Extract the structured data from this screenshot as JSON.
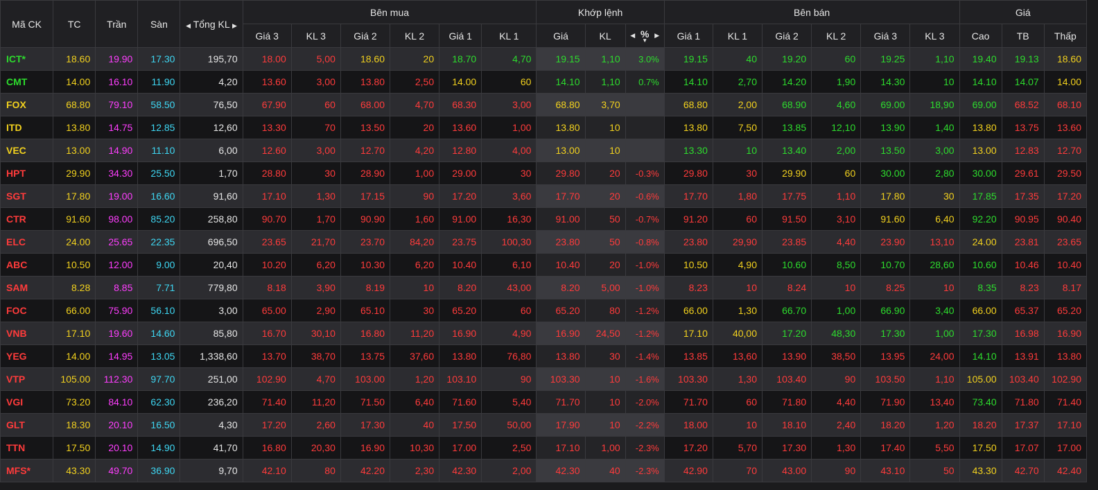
{
  "header": {
    "symbol": "Mã CK",
    "ref": "TC",
    "ceil": "Trần",
    "floor": "Sàn",
    "total_vol": "Tổng KL",
    "buy_group": "Bên mua",
    "match_group": "Khớp lệnh",
    "sell_group": "Bên bán",
    "price_group": "Giá",
    "price3": "Giá 3",
    "vol3": "KL 3",
    "price2": "Giá 2",
    "vol2": "KL 2",
    "price1": "Giá 1",
    "vol1": "KL 1",
    "match_price": "Giá",
    "match_vol": "KL",
    "match_pct": "%",
    "high": "Cao",
    "avg": "TB",
    "low": "Thấp"
  },
  "colors": {
    "up": "#2ddc2d",
    "down": "#ff3b3b",
    "ref": "#f2d11e",
    "ceil": "#ff3eff",
    "floor": "#3ed6f2",
    "neutral": "#e6e6e6"
  },
  "rows": [
    {
      "sym": "ICT*",
      "tc": "18.60",
      "ceil": "19.90",
      "floor": "17.30",
      "tv": "195,70",
      "bp3": "18.00",
      "bv3": "5,00",
      "bp2": "18.60",
      "bv2": "20",
      "bp1": "18.70",
      "bv1": "4,70",
      "mp": "19.15",
      "mv": "1,10",
      "pct": "3.0%",
      "sp1": "19.15",
      "sv1": "40",
      "sp2": "19.20",
      "sv2": "60",
      "sp3": "19.25",
      "sv3": "1,10",
      "hi": "19.40",
      "av": "19.13",
      "lo": "18.60"
    },
    {
      "sym": "CMT",
      "tc": "14.00",
      "ceil": "16.10",
      "floor": "11.90",
      "tv": "4,20",
      "bp3": "13.60",
      "bv3": "3,00",
      "bp2": "13.80",
      "bv2": "2,50",
      "bp1": "14.00",
      "bv1": "60",
      "mp": "14.10",
      "mv": "1,10",
      "pct": "0.7%",
      "sp1": "14.10",
      "sv1": "2,70",
      "sp2": "14.20",
      "sv2": "1,90",
      "sp3": "14.30",
      "sv3": "10",
      "hi": "14.10",
      "av": "14.07",
      "lo": "14.00"
    },
    {
      "sym": "FOX",
      "tc": "68.80",
      "ceil": "79.10",
      "floor": "58.50",
      "tv": "76,50",
      "bp3": "67.90",
      "bv3": "60",
      "bp2": "68.00",
      "bv2": "4,70",
      "bp1": "68.30",
      "bv1": "3,00",
      "mp": "68.80",
      "mv": "3,70",
      "pct": "",
      "sp1": "68.80",
      "sv1": "2,00",
      "sp2": "68.90",
      "sv2": "4,60",
      "sp3": "69.00",
      "sv3": "18,90",
      "hi": "69.00",
      "av": "68.52",
      "lo": "68.10"
    },
    {
      "sym": "ITD",
      "tc": "13.80",
      "ceil": "14.75",
      "floor": "12.85",
      "tv": "12,60",
      "bp3": "13.30",
      "bv3": "70",
      "bp2": "13.50",
      "bv2": "20",
      "bp1": "13.60",
      "bv1": "1,00",
      "mp": "13.80",
      "mv": "10",
      "pct": "",
      "sp1": "13.80",
      "sv1": "7,50",
      "sp2": "13.85",
      "sv2": "12,10",
      "sp3": "13.90",
      "sv3": "1,40",
      "hi": "13.80",
      "av": "13.75",
      "lo": "13.60"
    },
    {
      "sym": "VEC",
      "tc": "13.00",
      "ceil": "14.90",
      "floor": "11.10",
      "tv": "6,00",
      "bp3": "12.60",
      "bv3": "3,00",
      "bp2": "12.70",
      "bv2": "4,20",
      "bp1": "12.80",
      "bv1": "4,00",
      "mp": "13.00",
      "mv": "10",
      "pct": "",
      "sp1": "13.30",
      "sv1": "10",
      "sp2": "13.40",
      "sv2": "2,00",
      "sp3": "13.50",
      "sv3": "3,00",
      "hi": "13.00",
      "av": "12.83",
      "lo": "12.70"
    },
    {
      "sym": "HPT",
      "tc": "29.90",
      "ceil": "34.30",
      "floor": "25.50",
      "tv": "1,70",
      "bp3": "28.80",
      "bv3": "30",
      "bp2": "28.90",
      "bv2": "1,00",
      "bp1": "29.00",
      "bv1": "30",
      "mp": "29.80",
      "mv": "20",
      "pct": "-0.3%",
      "sp1": "29.80",
      "sv1": "30",
      "sp2": "29.90",
      "sv2": "60",
      "sp3": "30.00",
      "sv3": "2,80",
      "hi": "30.00",
      "av": "29.61",
      "lo": "29.50"
    },
    {
      "sym": "SGT",
      "tc": "17.80",
      "ceil": "19.00",
      "floor": "16.60",
      "tv": "91,60",
      "bp3": "17.10",
      "bv3": "1,30",
      "bp2": "17.15",
      "bv2": "90",
      "bp1": "17.20",
      "bv1": "3,60",
      "mp": "17.70",
      "mv": "20",
      "pct": "-0.6%",
      "sp1": "17.70",
      "sv1": "1,80",
      "sp2": "17.75",
      "sv2": "1,10",
      "sp3": "17.80",
      "sv3": "30",
      "hi": "17.85",
      "av": "17.35",
      "lo": "17.20"
    },
    {
      "sym": "CTR",
      "tc": "91.60",
      "ceil": "98.00",
      "floor": "85.20",
      "tv": "258,80",
      "bp3": "90.70",
      "bv3": "1,70",
      "bp2": "90.90",
      "bv2": "1,60",
      "bp1": "91.00",
      "bv1": "16,30",
      "mp": "91.00",
      "mv": "50",
      "pct": "-0.7%",
      "sp1": "91.20",
      "sv1": "60",
      "sp2": "91.50",
      "sv2": "3,10",
      "sp3": "91.60",
      "sv3": "6,40",
      "hi": "92.20",
      "av": "90.95",
      "lo": "90.40"
    },
    {
      "sym": "ELC",
      "tc": "24.00",
      "ceil": "25.65",
      "floor": "22.35",
      "tv": "696,50",
      "bp3": "23.65",
      "bv3": "21,70",
      "bp2": "23.70",
      "bv2": "84,20",
      "bp1": "23.75",
      "bv1": "100,30",
      "mp": "23.80",
      "mv": "50",
      "pct": "-0.8%",
      "sp1": "23.80",
      "sv1": "29,90",
      "sp2": "23.85",
      "sv2": "4,40",
      "sp3": "23.90",
      "sv3": "13,10",
      "hi": "24.00",
      "av": "23.81",
      "lo": "23.65"
    },
    {
      "sym": "ABC",
      "tc": "10.50",
      "ceil": "12.00",
      "floor": "9.00",
      "tv": "20,40",
      "bp3": "10.20",
      "bv3": "6,20",
      "bp2": "10.30",
      "bv2": "6,20",
      "bp1": "10.40",
      "bv1": "6,10",
      "mp": "10.40",
      "mv": "20",
      "pct": "-1.0%",
      "sp1": "10.50",
      "sv1": "4,90",
      "sp2": "10.60",
      "sv2": "8,50",
      "sp3": "10.70",
      "sv3": "28,60",
      "hi": "10.60",
      "av": "10.46",
      "lo": "10.40"
    },
    {
      "sym": "SAM",
      "tc": "8.28",
      "ceil": "8.85",
      "floor": "7.71",
      "tv": "779,80",
      "bp3": "8.18",
      "bv3": "3,90",
      "bp2": "8.19",
      "bv2": "10",
      "bp1": "8.20",
      "bv1": "43,00",
      "mp": "8.20",
      "mv": "5,00",
      "pct": "-1.0%",
      "sp1": "8.23",
      "sv1": "10",
      "sp2": "8.24",
      "sv2": "10",
      "sp3": "8.25",
      "sv3": "10",
      "hi": "8.35",
      "av": "8.23",
      "lo": "8.17"
    },
    {
      "sym": "FOC",
      "tc": "66.00",
      "ceil": "75.90",
      "floor": "56.10",
      "tv": "3,00",
      "bp3": "65.00",
      "bv3": "2,90",
      "bp2": "65.10",
      "bv2": "30",
      "bp1": "65.20",
      "bv1": "60",
      "mp": "65.20",
      "mv": "80",
      "pct": "-1.2%",
      "sp1": "66.00",
      "sv1": "1,30",
      "sp2": "66.70",
      "sv2": "1,00",
      "sp3": "66.90",
      "sv3": "3,40",
      "hi": "66.00",
      "av": "65.37",
      "lo": "65.20"
    },
    {
      "sym": "VNB",
      "tc": "17.10",
      "ceil": "19.60",
      "floor": "14.60",
      "tv": "85,80",
      "bp3": "16.70",
      "bv3": "30,10",
      "bp2": "16.80",
      "bv2": "11,20",
      "bp1": "16.90",
      "bv1": "4,90",
      "mp": "16.90",
      "mv": "24,50",
      "pct": "-1.2%",
      "sp1": "17.10",
      "sv1": "40,00",
      "sp2": "17.20",
      "sv2": "48,30",
      "sp3": "17.30",
      "sv3": "1,00",
      "hi": "17.30",
      "av": "16.98",
      "lo": "16.90"
    },
    {
      "sym": "YEG",
      "tc": "14.00",
      "ceil": "14.95",
      "floor": "13.05",
      "tv": "1,338,60",
      "bp3": "13.70",
      "bv3": "38,70",
      "bp2": "13.75",
      "bv2": "37,60",
      "bp1": "13.80",
      "bv1": "76,80",
      "mp": "13.80",
      "mv": "30",
      "pct": "-1.4%",
      "sp1": "13.85",
      "sv1": "13,60",
      "sp2": "13.90",
      "sv2": "38,50",
      "sp3": "13.95",
      "sv3": "24,00",
      "hi": "14.10",
      "av": "13.91",
      "lo": "13.80"
    },
    {
      "sym": "VTP",
      "tc": "105.00",
      "ceil": "112.30",
      "floor": "97.70",
      "tv": "251,00",
      "bp3": "102.90",
      "bv3": "4,70",
      "bp2": "103.00",
      "bv2": "1,20",
      "bp1": "103.10",
      "bv1": "90",
      "mp": "103.30",
      "mv": "10",
      "pct": "-1.6%",
      "sp1": "103.30",
      "sv1": "1,30",
      "sp2": "103.40",
      "sv2": "90",
      "sp3": "103.50",
      "sv3": "1,10",
      "hi": "105.00",
      "av": "103.40",
      "lo": "102.90"
    },
    {
      "sym": "VGI",
      "tc": "73.20",
      "ceil": "84.10",
      "floor": "62.30",
      "tv": "236,20",
      "bp3": "71.40",
      "bv3": "11,20",
      "bp2": "71.50",
      "bv2": "6,40",
      "bp1": "71.60",
      "bv1": "5,40",
      "mp": "71.70",
      "mv": "10",
      "pct": "-2.0%",
      "sp1": "71.70",
      "sv1": "60",
      "sp2": "71.80",
      "sv2": "4,40",
      "sp3": "71.90",
      "sv3": "13,40",
      "hi": "73.40",
      "av": "71.80",
      "lo": "71.40"
    },
    {
      "sym": "GLT",
      "tc": "18.30",
      "ceil": "20.10",
      "floor": "16.50",
      "tv": "4,30",
      "bp3": "17.20",
      "bv3": "2,60",
      "bp2": "17.30",
      "bv2": "40",
      "bp1": "17.50",
      "bv1": "50,00",
      "mp": "17.90",
      "mv": "10",
      "pct": "-2.2%",
      "sp1": "18.00",
      "sv1": "10",
      "sp2": "18.10",
      "sv2": "2,40",
      "sp3": "18.20",
      "sv3": "1,20",
      "hi": "18.20",
      "av": "17.37",
      "lo": "17.10"
    },
    {
      "sym": "TTN",
      "tc": "17.50",
      "ceil": "20.10",
      "floor": "14.90",
      "tv": "41,70",
      "bp3": "16.80",
      "bv3": "20,30",
      "bp2": "16.90",
      "bv2": "10,30",
      "bp1": "17.00",
      "bv1": "2,50",
      "mp": "17.10",
      "mv": "1,00",
      "pct": "-2.3%",
      "sp1": "17.20",
      "sv1": "5,70",
      "sp2": "17.30",
      "sv2": "1,30",
      "sp3": "17.40",
      "sv3": "5,50",
      "hi": "17.50",
      "av": "17.07",
      "lo": "17.00"
    },
    {
      "sym": "MFS*",
      "tc": "43.30",
      "ceil": "49.70",
      "floor": "36.90",
      "tv": "9,70",
      "bp3": "42.10",
      "bv3": "80",
      "bp2": "42.20",
      "bv2": "2,30",
      "bp1": "42.30",
      "bv1": "2,00",
      "mp": "42.30",
      "mv": "40",
      "pct": "-2.3%",
      "sp1": "42.90",
      "sv1": "70",
      "sp2": "43.00",
      "sv2": "90",
      "sp3": "43.10",
      "sv3": "50",
      "hi": "43.30",
      "av": "42.70",
      "lo": "42.40"
    }
  ]
}
